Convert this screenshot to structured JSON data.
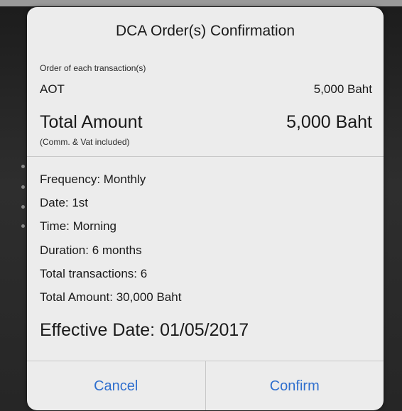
{
  "dialog": {
    "title": "DCA Order(s) Confirmation",
    "order_label": "Order of each transaction(s)",
    "stock": {
      "name": "AOT",
      "amount": "5,000 Baht"
    },
    "total": {
      "label": "Total Amount",
      "sublabel": "(Comm. & Vat included)",
      "amount": "5,000 Baht"
    },
    "details": [
      "Frequency: Monthly",
      "Date: 1st",
      "Time: Morning",
      "Duration: 6 months",
      "Total transactions: 6",
      "Total Amount: 30,000 Baht"
    ],
    "effective_date": "Effective Date: 01/05/2017",
    "buttons": {
      "cancel": "Cancel",
      "confirm": "Confirm"
    }
  },
  "colors": {
    "dialog_bg": "#ececec",
    "button_text": "#2f6fce",
    "text": "#1a1a1a",
    "backdrop": "#2a2a2a"
  }
}
